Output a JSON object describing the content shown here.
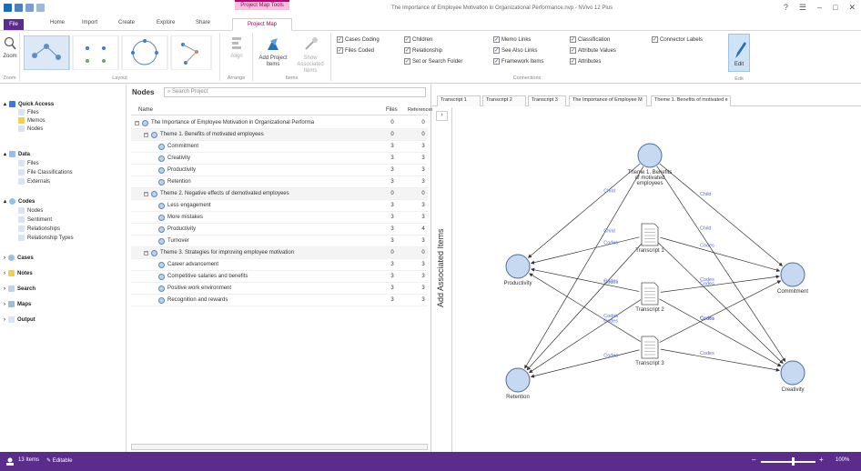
{
  "window": {
    "title": "The Importance of Employee Motivation in Organizational Performance.nvp - NVivo 12 Plus",
    "context_tab": "Project Map Tools"
  },
  "ribbon_tabs": {
    "file": "File",
    "home": "Home",
    "import": "Import",
    "create": "Create",
    "explore": "Explore",
    "share": "Share",
    "project_map": "Project Map"
  },
  "ribbon": {
    "zoom": "Zoom",
    "zoom_group": "Zoom",
    "layout_group": "Layout",
    "align": "Align",
    "arrange_group": "Arrange",
    "add_project_items": "Add Project Items",
    "show_associated": "Show Associated Items",
    "items_group": "Items",
    "checks": {
      "cases_coding": "Cases Coding",
      "files_coded": "Files Coded",
      "children": "Children",
      "relationship": "Relationship",
      "set_or_search_folder": "Set or Search Folder",
      "memo_links": "Memo Links",
      "see_also_links": "See Also Links",
      "framework_items": "Framework Items",
      "classification": "Classification",
      "attribute_values": "Attribute Values",
      "attributes": "Attributes",
      "connector_labels": "Connector Labels"
    },
    "connections_group": "Connections",
    "edit": "Edit",
    "edit_group": "Edit"
  },
  "nav": {
    "quick_access": "Quick Access",
    "qa_files": "Files",
    "qa_memos": "Memos",
    "qa_nodes": "Nodes",
    "data": "Data",
    "d_files": "Files",
    "d_file_classifications": "File Classifications",
    "d_externals": "Externals",
    "codes": "Codes",
    "c_nodes": "Nodes",
    "c_sentiment": "Sentiment",
    "c_relationships": "Relationships",
    "c_relationship_types": "Relationship Types",
    "cases": "Cases",
    "notes": "Notes",
    "search": "Search",
    "maps": "Maps",
    "output": "Output"
  },
  "nodes": {
    "title": "Nodes",
    "search_placeholder": "Search Project",
    "col_name": "Name",
    "col_files": "Files",
    "col_references": "References",
    "root": {
      "name": "The Importance of Employee Motivation in Organizational Performa",
      "files": "0",
      "refs": "0"
    },
    "rows": [
      {
        "name": "Theme 1. Benefits of motivated employees",
        "files": "0",
        "refs": "0",
        "level": 1
      },
      {
        "name": "Commitment",
        "files": "3",
        "refs": "3",
        "level": 2
      },
      {
        "name": "Creativity",
        "files": "3",
        "refs": "3",
        "level": 2
      },
      {
        "name": "Productivity",
        "files": "3",
        "refs": "3",
        "level": 2
      },
      {
        "name": "Retention",
        "files": "3",
        "refs": "3",
        "level": 2
      },
      {
        "name": "Theme 2. Negative effects of demotivated employees",
        "files": "0",
        "refs": "0",
        "level": 1
      },
      {
        "name": "Less engagement",
        "files": "3",
        "refs": "3",
        "level": 2
      },
      {
        "name": "More mistakes",
        "files": "3",
        "refs": "3",
        "level": 2
      },
      {
        "name": "Productivity",
        "files": "3",
        "refs": "4",
        "level": 2
      },
      {
        "name": "Turnover",
        "files": "3",
        "refs": "3",
        "level": 2
      },
      {
        "name": "Theme 3. Strategies for improving employee motivation",
        "files": "0",
        "refs": "0",
        "level": 1
      },
      {
        "name": "Career advancement",
        "files": "3",
        "refs": "3",
        "level": 2
      },
      {
        "name": "Competitive salaries and benefits",
        "files": "3",
        "refs": "3",
        "level": 2
      },
      {
        "name": "Positive work environment",
        "files": "3",
        "refs": "3",
        "level": 2
      },
      {
        "name": "Recognition and rewards",
        "files": "3",
        "refs": "3",
        "level": 2
      }
    ]
  },
  "assoc_label": "Add Associated Items",
  "doc_tabs": [
    "Transcript 1",
    "Transcript 2",
    "Transcript 3",
    "The Importance of Employee M",
    "Theme 1. Benefits of motivated e"
  ],
  "map": {
    "nodes": {
      "theme": "Theme 1. Benefits of motivated employees",
      "productivity": "Productivity",
      "commitment": "Commitment",
      "retention": "Retention",
      "creativity": "Creativity",
      "t1": "Transcript 1",
      "t2": "Transcript 2",
      "t3": "Transcript 3"
    },
    "edge_child": "Child",
    "edge_codes": "Codes",
    "node_color": "#c6d9f1",
    "node_stroke": "#4a6e9c"
  },
  "status": {
    "items": "13 Items",
    "editable": "Editable",
    "zoom": "100%"
  },
  "colors": {
    "accent": "#5b2c8c",
    "pink": "#c0007a"
  }
}
